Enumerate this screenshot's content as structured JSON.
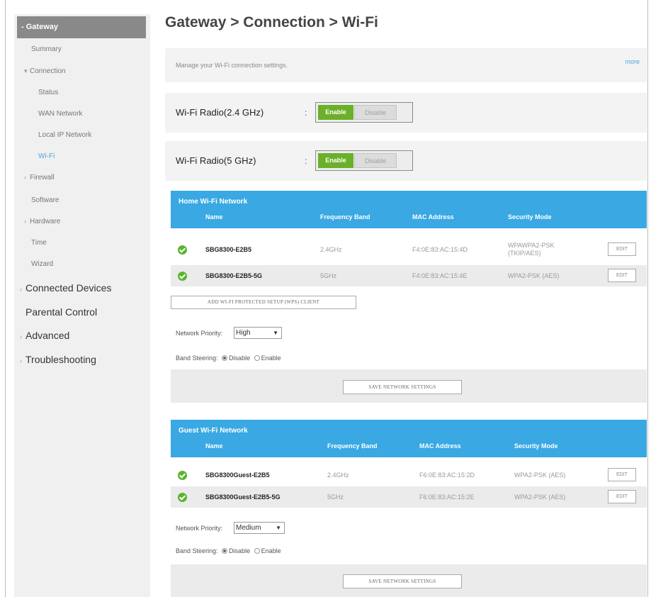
{
  "sidebar": {
    "items": [
      {
        "label": "Gateway",
        "active": true
      },
      {
        "label": "Summary"
      },
      {
        "label": "Connection"
      },
      {
        "label": "Status"
      },
      {
        "label": "WAN Network"
      },
      {
        "label": "Local IP Network"
      },
      {
        "label": "Wi-Fi",
        "selected": true
      },
      {
        "label": "Firewall"
      },
      {
        "label": "Software"
      },
      {
        "label": "Hardware"
      },
      {
        "label": "Time"
      },
      {
        "label": "Wizard"
      },
      {
        "label": "Connected Devices"
      },
      {
        "label": "Parental Control"
      },
      {
        "label": "Advanced"
      },
      {
        "label": "Troubleshooting"
      }
    ]
  },
  "header": {
    "title": "Gateway > Connection > Wi-Fi"
  },
  "description": {
    "text": "Manage your Wi-Fi connection settings.",
    "help": "more"
  },
  "radio24": {
    "label": "Wi-Fi Radio(2.4 GHz)",
    "colon": ":",
    "enable": "Enable",
    "disable": "Disable",
    "state": "Enable"
  },
  "radio5": {
    "label": "Wi-Fi Radio(5 GHz)",
    "colon": ":",
    "enable": "Enable",
    "disable": "Disable",
    "state": "Enable"
  },
  "home": {
    "title": "Home Wi-Fi Network",
    "columns": [
      "Name",
      "Frequency Band",
      "MAC Address",
      "Security Mode"
    ],
    "rows": [
      {
        "name": "SBG8300-E2B5",
        "band": "2.4GHz",
        "mac": "F4:0E:83:AC:15:4D",
        "sec_line1": "WPAWPA2-PSK",
        "sec_line2": "(TKIP/AES)",
        "edit": "EDIT"
      },
      {
        "name": "SBG8300-E2B5-5G",
        "band": "5GHz",
        "mac": "F4:0E:83:AC:15:4E",
        "security": "WPA2-PSK (AES)",
        "edit": "EDIT"
      }
    ],
    "wps_button": "ADD WI-FI PROTECTED SETUP (WPS) CLIENT",
    "priority_label": "Network Priority:",
    "priority_value": "High",
    "band_label": "Band Steering:",
    "band_disable": "Disable",
    "band_enable": "Enable",
    "band_value": "Disable",
    "save": "SAVE NETWORK SETTINGS"
  },
  "guest": {
    "title": "Guest Wi-Fi Network",
    "columns": [
      "Name",
      "Frequency Band",
      "MAC Address",
      "Security Mode"
    ],
    "rows": [
      {
        "name": "SBG8300Guest-E2B5",
        "band": "2.4GHz",
        "mac": "F6:0E:83:AC:15:2D",
        "security": "WPA2-PSK (AES)",
        "edit": "EDIT"
      },
      {
        "name": "SBG8300Guest-E2B5-5G",
        "band": "5GHz",
        "mac": "F6:0E:83:AC:15:2E",
        "security": "WPA2-PSK (AES)",
        "edit": "EDIT"
      }
    ],
    "priority_label": "Network Priority:",
    "priority_value": "Medium",
    "band_label": "Band Steering:",
    "band_disable": "Disable",
    "band_enable": "Enable",
    "band_value": "Disable",
    "save": "SAVE NETWORK SETTINGS"
  },
  "colors": {
    "accent": "#39a8e3",
    "enable_green": "#6ab029",
    "status_green": "#58b52e",
    "sidebar_active": "#898989"
  },
  "icons": {
    "status": "check-circle-icon",
    "expanded": "caret-down-icon",
    "collapsed": "caret-right-icon"
  }
}
